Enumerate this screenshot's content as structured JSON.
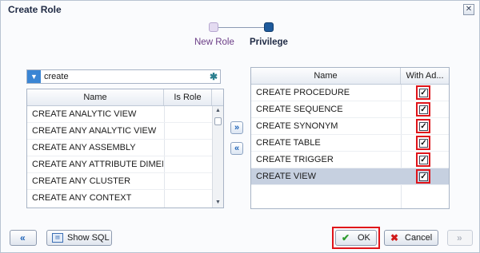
{
  "dialog": {
    "title": "Create Role"
  },
  "train": {
    "steps": [
      {
        "label": "New Role"
      },
      {
        "label": "Privilege"
      }
    ]
  },
  "search": {
    "value": "create"
  },
  "available": {
    "columns": [
      "Name",
      "Is Role"
    ],
    "rows": [
      "CREATE ANALYTIC VIEW",
      "CREATE ANY ANALYTIC VIEW",
      "CREATE ANY ASSEMBLY",
      "CREATE ANY ATTRIBUTE DIMENSION",
      "CREATE ANY CLUSTER",
      "CREATE ANY CONTEXT"
    ]
  },
  "selected": {
    "columns": [
      "Name",
      "With Ad..."
    ],
    "rows": [
      {
        "name": "CREATE PROCEDURE",
        "with_admin": true
      },
      {
        "name": "CREATE SEQUENCE",
        "with_admin": true
      },
      {
        "name": "CREATE SYNONYM",
        "with_admin": true
      },
      {
        "name": "CREATE TABLE",
        "with_admin": true
      },
      {
        "name": "CREATE TRIGGER",
        "with_admin": true
      },
      {
        "name": "CREATE VIEW",
        "with_admin": true
      }
    ],
    "highlighted_row": "CREATE VIEW"
  },
  "footer": {
    "show_sql": "Show SQL",
    "ok": "OK",
    "cancel": "Cancel"
  },
  "icons": {
    "close": "close-icon",
    "dropdown": "dropdown-icon",
    "clear": "clear-icon",
    "move_right": "chevron-right-icon",
    "move_left": "chevron-left-icon",
    "back": "back-icon",
    "sql": "sql-icon",
    "ok": "checkmark-icon",
    "cancel": "cancel-icon",
    "next": "next-icon"
  },
  "colors": {
    "accent": "#1e5a9c",
    "highlight": "#e0141a",
    "selected_row": "#c6d0e0",
    "visited_step": "#6a3c86"
  }
}
